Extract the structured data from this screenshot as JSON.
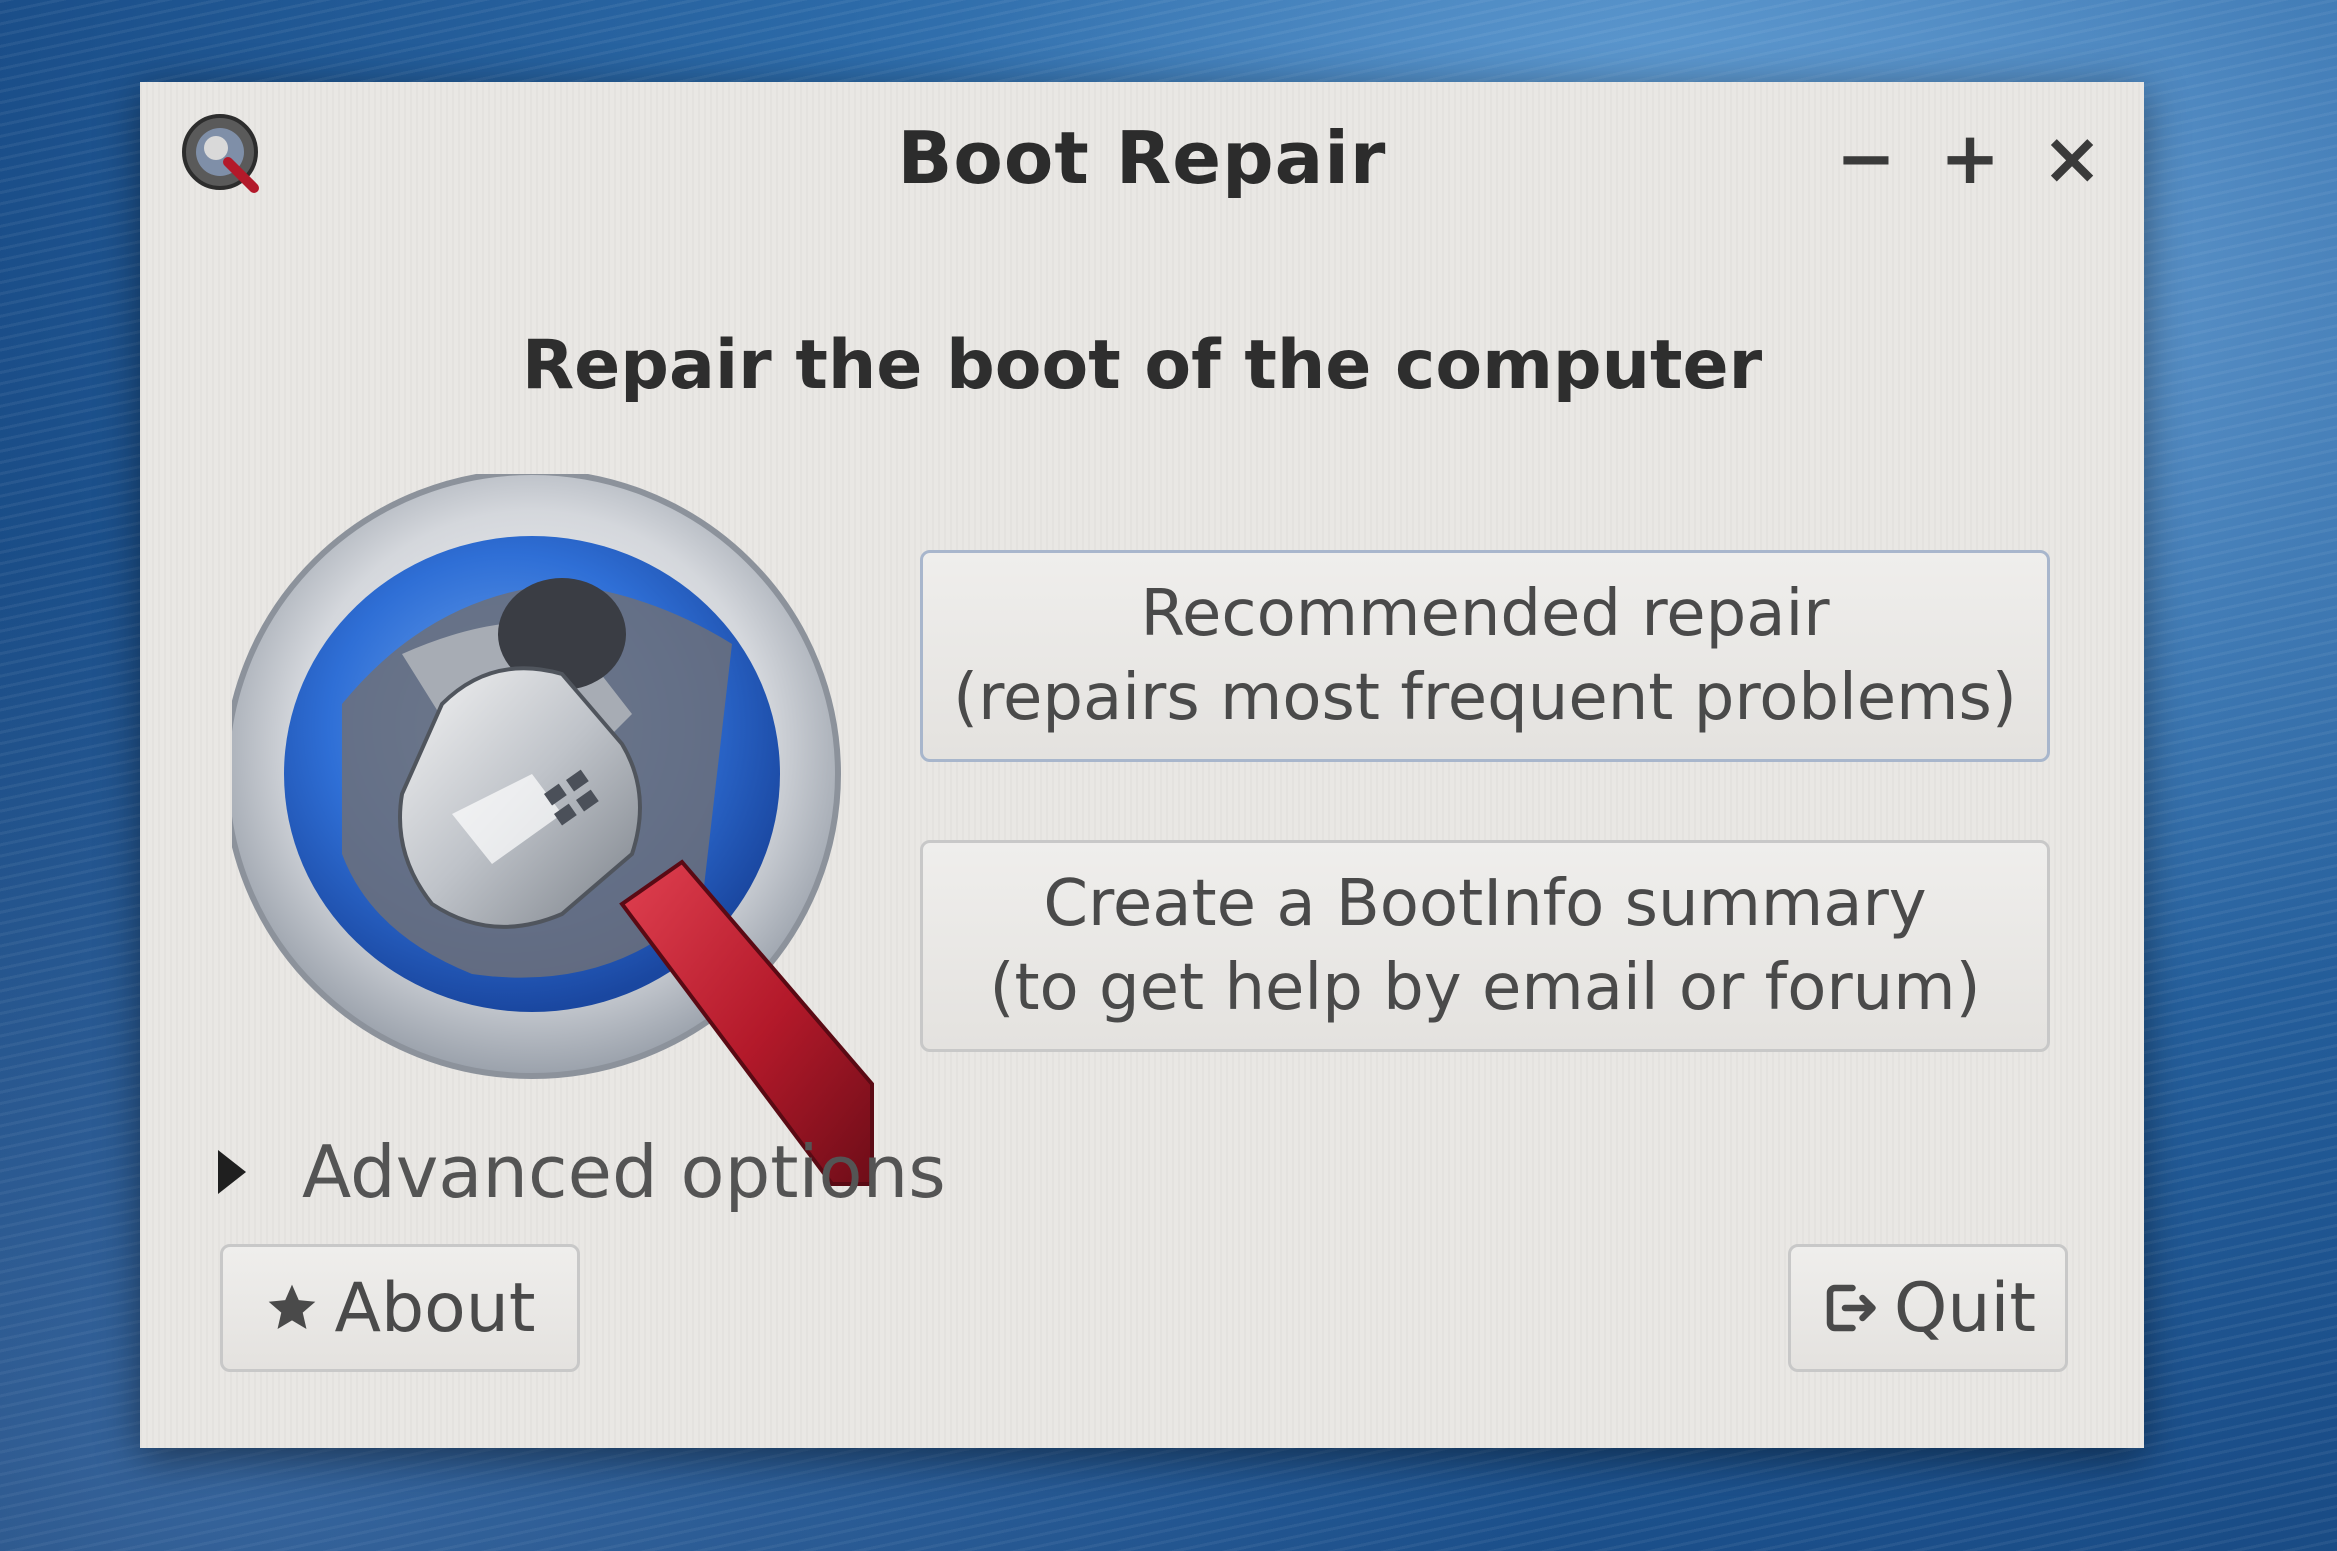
{
  "window": {
    "title": "Boot Repair",
    "controls": {
      "minimize": "−",
      "maximize": "+",
      "close": "×"
    }
  },
  "main": {
    "heading": "Repair the boot of the computer",
    "recommended_repair": {
      "line1": "Recommended repair",
      "line2": "(repairs most frequent problems)"
    },
    "bootinfo_summary": {
      "line1": "Create a BootInfo summary",
      "line2": "(to get help by email or forum)"
    },
    "advanced_options": "Advanced options"
  },
  "footer": {
    "about_label": "About",
    "about_icon": "star-icon",
    "quit_label": "Quit",
    "quit_icon": "exit-icon"
  },
  "colors": {
    "window_bg": "#e9e7e4",
    "logo_ring_blue": "#2f6fd6",
    "wrench_handle_red": "#b3192a"
  }
}
